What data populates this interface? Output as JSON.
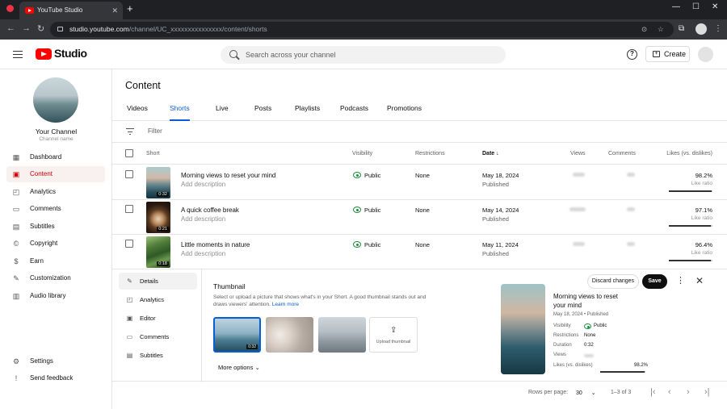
{
  "browser": {
    "tab_title": "YouTube Studio",
    "url_host": "studio.youtube.com",
    "url_path": "/channel/UC_xxxxxxxxxxxxxxx/content/shorts"
  },
  "header": {
    "logo_text": "Studio",
    "search_placeholder": "Search across your channel",
    "create_label": "Create"
  },
  "channel": {
    "name": "Your Channel",
    "subtitle": "Channel name"
  },
  "sidebar": {
    "items": [
      {
        "label": "Dashboard",
        "icon": "dashboard-icon"
      },
      {
        "label": "Content",
        "icon": "content-icon"
      },
      {
        "label": "Analytics",
        "icon": "analytics-icon"
      },
      {
        "label": "Comments",
        "icon": "comments-icon"
      },
      {
        "label": "Subtitles",
        "icon": "subtitles-icon"
      },
      {
        "label": "Copyright",
        "icon": "copyright-icon"
      },
      {
        "label": "Earn",
        "icon": "earn-icon"
      },
      {
        "label": "Customization",
        "icon": "customization-icon"
      },
      {
        "label": "Audio library",
        "icon": "audio-library-icon"
      }
    ],
    "bottom": [
      {
        "label": "Settings",
        "icon": "settings-icon"
      },
      {
        "label": "Send feedback",
        "icon": "feedback-icon"
      }
    ]
  },
  "main": {
    "title": "Content",
    "tabs": [
      "Videos",
      "Shorts",
      "Live",
      "Posts",
      "Playlists",
      "Podcasts",
      "Promotions"
    ],
    "filter_label": "Filter"
  },
  "table": {
    "headers": {
      "short": "Short",
      "visibility": "Visibility",
      "restrictions": "Restrictions",
      "date": "Date",
      "views": "Views",
      "comments": "Comments",
      "likes": "Likes (vs. dislikes)"
    },
    "rows": [
      {
        "title": "Morning views to reset your mind",
        "desc": "Add description",
        "duration": "0:32",
        "visibility": "Public",
        "restrictions": "None",
        "date": "May 18, 2024",
        "status": "Published",
        "likes": "98.2%",
        "likes_label": "Like ratio",
        "like_ratio": 0.982
      },
      {
        "title": "A quick coffee break",
        "desc": "Add description",
        "duration": "0:21",
        "visibility": "Public",
        "restrictions": "None",
        "date": "May 14, 2024",
        "status": "Published",
        "likes": "97.1%",
        "likes_label": "Like ratio",
        "like_ratio": 0.971
      },
      {
        "title": "Little moments in nature",
        "desc": "Add description",
        "duration": "0:18",
        "visibility": "Public",
        "restrictions": "None",
        "date": "May 11, 2024",
        "status": "Published",
        "likes": "96.4%",
        "likes_label": "Like ratio",
        "like_ratio": 0.964
      }
    ]
  },
  "details": {
    "nav": [
      "Details",
      "Analytics",
      "Editor",
      "Comments",
      "Subtitles"
    ],
    "thumbnail_heading": "Thumbnail",
    "thumbnail_desc": "Select or upload a picture that shows what's in your Short. A good thumbnail stands out and draws viewers' attention.",
    "learn_more": "Learn more",
    "selected_badge": "0:32",
    "upload_label": "Upload thumbnail",
    "more_options": "More options",
    "discard": "Discard changes",
    "save": "Save",
    "preview": {
      "title": "Morning views to reset your mind",
      "date": "May 18, 2024 • Published",
      "visibility_k": "Visibility",
      "visibility_v": "Public",
      "restrictions_k": "Restrictions",
      "restrictions_v": "None",
      "duration_k": "Duration",
      "duration_v": "0:32",
      "views_k": "Views",
      "likes_k": "Likes (vs. dislikes)",
      "likes_v": "98.2%",
      "like_ratio": 0.982
    }
  },
  "footer": {
    "rows_per_page": "Rows per page:",
    "rows_value": "30",
    "range": "1–3 of 3"
  }
}
